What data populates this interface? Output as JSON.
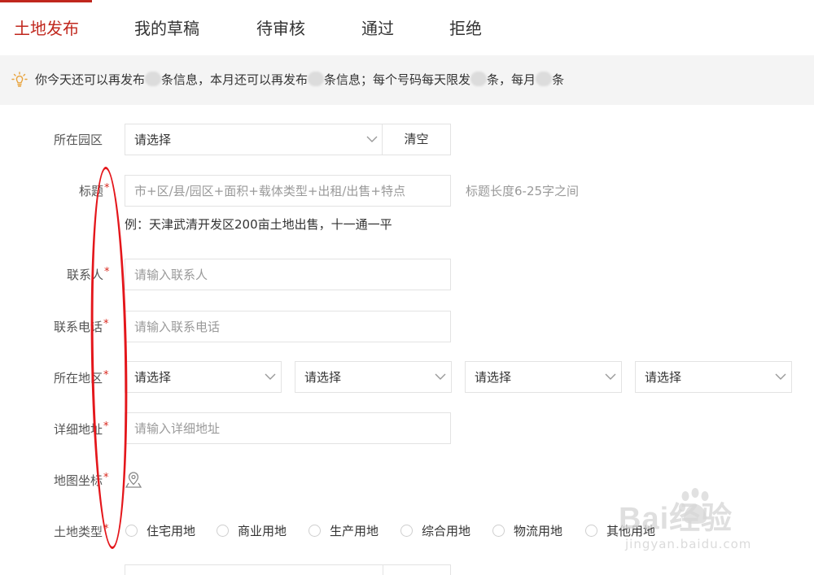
{
  "tabs": [
    {
      "label": "土地发布",
      "active": true
    },
    {
      "label": "我的草稿",
      "active": false
    },
    {
      "label": "待审核",
      "active": false
    },
    {
      "label": "通过",
      "active": false
    },
    {
      "label": "拒绝",
      "active": false
    }
  ],
  "notice": {
    "icon": "lightbulb-icon",
    "part1": "你今天还可以再发布",
    "part2": "条信息，本月还可以再发布",
    "part3": "条信息；每个号码每天限发",
    "part4": "条，每月",
    "part5": "条"
  },
  "form": {
    "park": {
      "label": "所在园区",
      "value": "请选择",
      "clear_label": "清空"
    },
    "title": {
      "label": "标题",
      "required_mark": "*",
      "placeholder": "市+区/县/园区+面积+载体类型+出租/出售+特点",
      "hint": "标题长度6-25字之间",
      "example": "例：天津武清开发区200亩土地出售，十一通一平"
    },
    "contact": {
      "label": "联系人",
      "required_mark": "*",
      "placeholder": "请输入联系人"
    },
    "phone": {
      "label": "联系电话",
      "required_mark": "*",
      "placeholder": "请输入联系电话"
    },
    "region": {
      "label": "所在地区",
      "required_mark": "*",
      "selects": [
        "请选择",
        "请选择",
        "请选择",
        "请选择"
      ]
    },
    "address": {
      "label": "详细地址",
      "required_mark": "*",
      "placeholder": "请输入详细地址"
    },
    "map": {
      "label": "地图坐标",
      "required_mark": "*",
      "icon": "map-pin-icon"
    },
    "land_type": {
      "label": "土地类型",
      "required_mark": "*",
      "options": [
        "住宅用地",
        "商业用地",
        "生产用地",
        "综合用地",
        "物流用地",
        "其他用地"
      ]
    }
  },
  "watermark": {
    "brand": "Bai经验",
    "url": "jingyan.baidu.com"
  },
  "colors": {
    "accent": "#c0271d",
    "required": "#d9281e",
    "annotation": "#e4161b",
    "notice_bg": "#f4f4f4"
  }
}
